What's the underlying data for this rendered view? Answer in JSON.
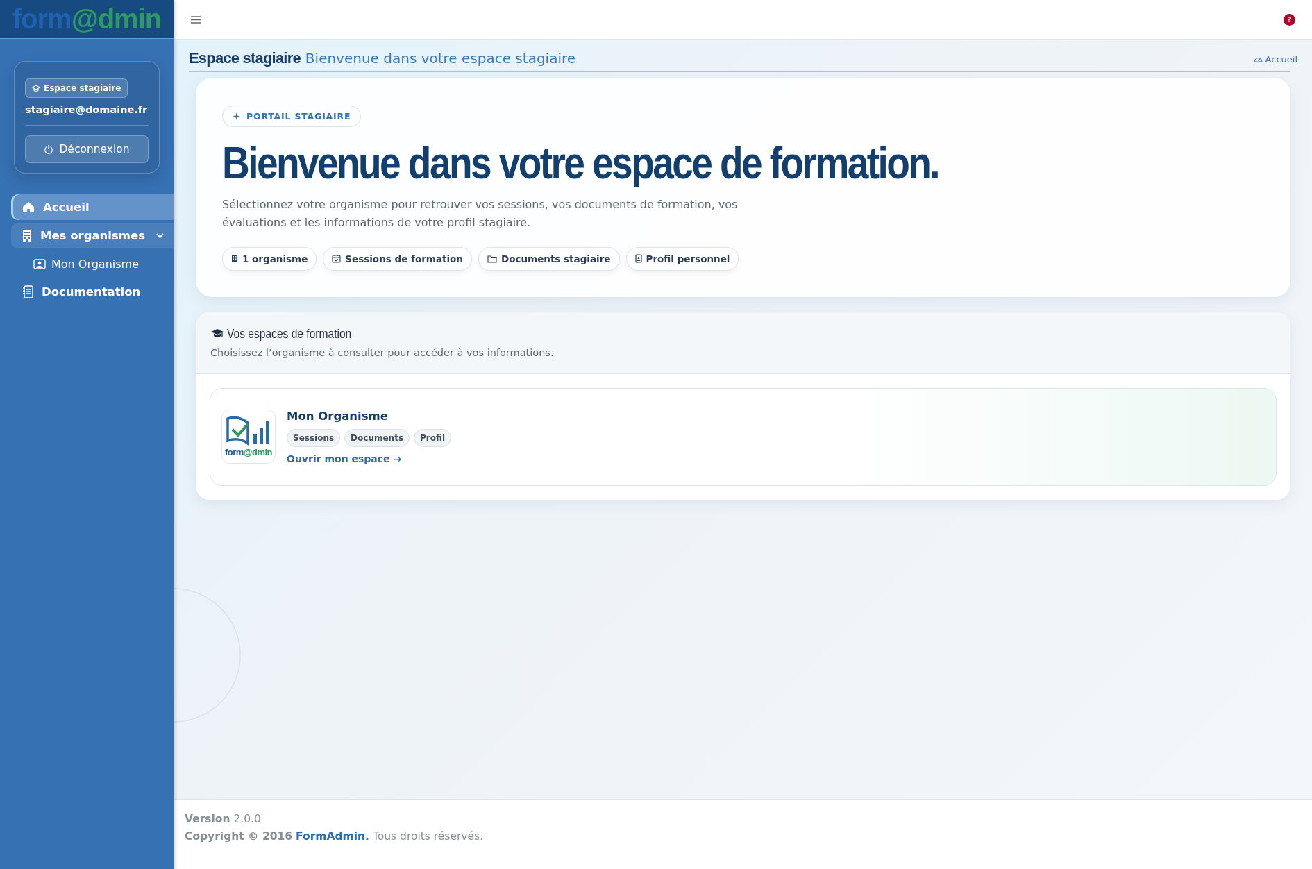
{
  "sidebar": {
    "logo": {
      "part_1": "form",
      "part_2": "@dmin"
    },
    "user_panel": {
      "role_badge": "Espace stagiaire",
      "email": "stagiaire@domaine.fr",
      "logout_button": "Déconnexion"
    },
    "nav_items": [
      {
        "label": "Accueil",
        "selected": true
      },
      {
        "label": "Mes organismes",
        "selected": false,
        "expanded": true,
        "children": [
          {
            "label": "Mon Organisme",
            "selected": false
          }
        ]
      },
      {
        "label": "Documentation",
        "selected": false
      }
    ]
  },
  "topbar": {
    "help_badge": "?"
  },
  "page_header": {
    "title": "Espace stagiaire",
    "subtitle": "Bienvenue dans votre espace stagiaire",
    "breadcrumb": "Accueil"
  },
  "hero": {
    "eyebrow": "PORTAIL STAGIAIRE",
    "heading": "Bienvenue dans votre espace de formation.",
    "description": "Sélectionnez votre organisme pour retrouver vos sessions, vos documents de formation, vos évaluations et les informations de votre profil stagiaire.",
    "chips": [
      "1 organisme",
      "Sessions de formation",
      "Documents stagiaire",
      "Profil personnel"
    ]
  },
  "spaces": {
    "title": "Vos espaces de formation",
    "subtitle": "Choisissez l’organisme à consulter pour accéder à vos informations.",
    "organizations": [
      {
        "name": "Mon Organisme",
        "logo_text": {
          "part_1": "form",
          "part_2": "@dmin"
        },
        "tags": [
          "Sessions",
          "Documents",
          "Profil"
        ],
        "link": "Ouvrir mon espace →"
      }
    ]
  },
  "footer": {
    "version": "**Version** 2.0.0",
    "copyright_prefix": "Copyright © 2016",
    "copyright_link": "FormAdmin.",
    "copyright_suffix": "Tous droits réservés."
  }
}
